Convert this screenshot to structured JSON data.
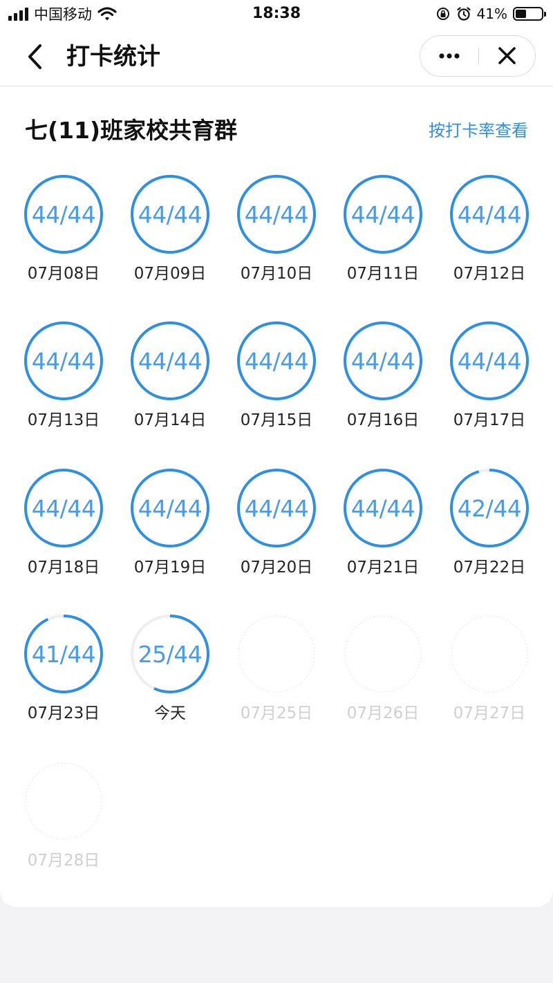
{
  "status_bar": {
    "carrier": "中国移动",
    "time": "18:38",
    "battery": "41%",
    "battery_level": 0.41
  },
  "nav": {
    "title": "打卡统计",
    "more_icon": "ellipsis-icon",
    "close_icon": "close-icon",
    "back_icon": "chevron-left-icon"
  },
  "group": {
    "name": "七(11)班家校共育群",
    "view_toggle": "按打卡率查看"
  },
  "colors": {
    "accent": "#2f8fe0",
    "ring_track": "#eeeeee",
    "future": "#cfcfcf"
  },
  "days": [
    {
      "label": "07月08日",
      "count": "44/44",
      "done": 44,
      "total": 44
    },
    {
      "label": "07月09日",
      "count": "44/44",
      "done": 44,
      "total": 44
    },
    {
      "label": "07月10日",
      "count": "44/44",
      "done": 44,
      "total": 44
    },
    {
      "label": "07月11日",
      "count": "44/44",
      "done": 44,
      "total": 44
    },
    {
      "label": "07月12日",
      "count": "44/44",
      "done": 44,
      "total": 44
    },
    {
      "label": "07月13日",
      "count": "44/44",
      "done": 44,
      "total": 44
    },
    {
      "label": "07月14日",
      "count": "44/44",
      "done": 44,
      "total": 44
    },
    {
      "label": "07月15日",
      "count": "44/44",
      "done": 44,
      "total": 44
    },
    {
      "label": "07月16日",
      "count": "44/44",
      "done": 44,
      "total": 44
    },
    {
      "label": "07月17日",
      "count": "44/44",
      "done": 44,
      "total": 44
    },
    {
      "label": "07月18日",
      "count": "44/44",
      "done": 44,
      "total": 44
    },
    {
      "label": "07月19日",
      "count": "44/44",
      "done": 44,
      "total": 44
    },
    {
      "label": "07月20日",
      "count": "44/44",
      "done": 44,
      "total": 44
    },
    {
      "label": "07月21日",
      "count": "44/44",
      "done": 44,
      "total": 44
    },
    {
      "label": "07月22日",
      "count": "42/44",
      "done": 42,
      "total": 44
    },
    {
      "label": "07月23日",
      "count": "41/44",
      "done": 41,
      "total": 44
    },
    {
      "label": "今天",
      "count": "25/44",
      "done": 25,
      "total": 44
    },
    {
      "label": "07月25日",
      "count": "",
      "future": true
    },
    {
      "label": "07月26日",
      "count": "",
      "future": true
    },
    {
      "label": "07月27日",
      "count": "",
      "future": true
    },
    {
      "label": "07月28日",
      "count": "",
      "future": true
    }
  ]
}
